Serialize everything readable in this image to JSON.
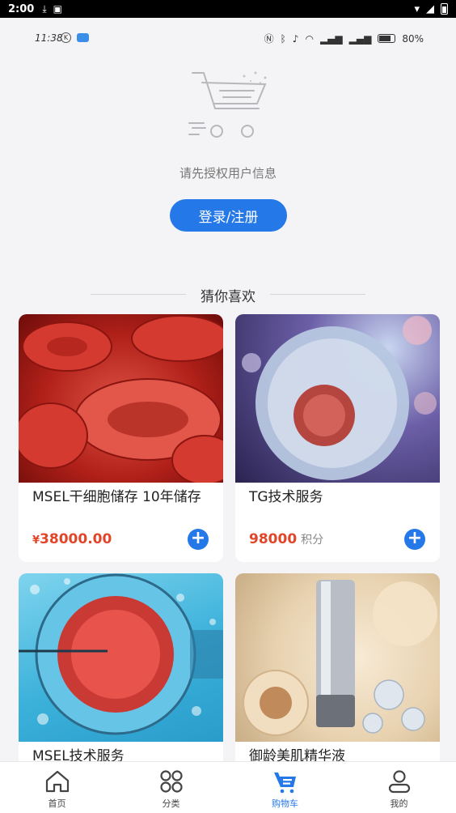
{
  "status_bar": {
    "time": "2:00"
  },
  "inner_status": {
    "time": "11:38",
    "badge": "K",
    "battery": "80%"
  },
  "empty_cart": {
    "message": "请先授权用户信息",
    "login_label": "登录/注册"
  },
  "recommend": {
    "title": "猜你喜欢",
    "products": [
      {
        "name": "MSEL干细胞储存 10年储存",
        "currency": "¥",
        "price": "38000.00",
        "unit": "",
        "image": "red-blood-cells"
      },
      {
        "name": "TG技术服务",
        "currency": "",
        "price": "98000",
        "unit": "积分",
        "image": "cell-nucleus"
      },
      {
        "name": "MSEL技术服务",
        "currency": "",
        "price": "",
        "unit": "",
        "image": "egg-cell-microinjection"
      },
      {
        "name": "御龄美肌精华液",
        "currency": "",
        "price": "",
        "unit": "",
        "image": "serum-bottle"
      }
    ]
  },
  "tabs": [
    {
      "label": "首页",
      "icon": "home-icon",
      "active": false
    },
    {
      "label": "分类",
      "icon": "grid-icon",
      "active": false
    },
    {
      "label": "购物车",
      "icon": "cart-icon",
      "active": true
    },
    {
      "label": "我的",
      "icon": "user-icon",
      "active": false
    }
  ],
  "colors": {
    "accent": "#2478e8",
    "price": "#e2462a",
    "background": "#f4f4f6"
  }
}
